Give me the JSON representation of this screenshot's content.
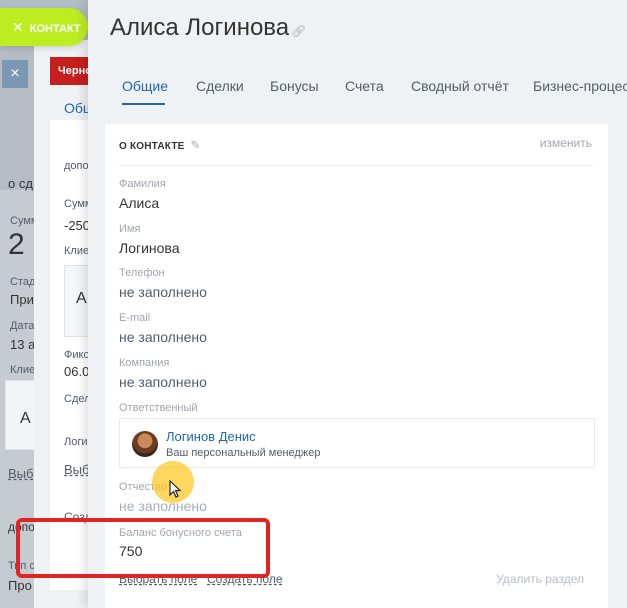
{
  "colors": {
    "accent": "#2067b0",
    "contact_button": "#bbed21",
    "highlight": "#e02424",
    "cursor_halo": "#ffc828"
  },
  "background": {
    "contact_button_label": "КОНТАКТ",
    "red_button_label": "Черно",
    "close_label": "×",
    "layer1": {
      "texts": [
        "о сд",
        "Сумм",
        "2",
        "Стад",
        "При",
        "Дата",
        "13 а",
        "Клие",
        "А",
        "Выб",
        "допо",
        "Тип с",
        "Про"
      ]
    },
    "layer2": {
      "texts": [
        "Общ",
        "допо",
        "Сумм",
        "-250",
        "Клие",
        "А",
        "Фикс",
        "06.0",
        "Сдел",
        "Логи",
        "Выб",
        "Созд"
      ]
    }
  },
  "header": {
    "title": "Алиса  Логинова"
  },
  "tabs": [
    {
      "label": "Общие",
      "active": true
    },
    {
      "label": "Сделки",
      "active": false
    },
    {
      "label": "Бонусы",
      "active": false
    },
    {
      "label": "Счета",
      "active": false
    },
    {
      "label": "Сводный отчёт",
      "active": false
    },
    {
      "label": "Бизнес-процессы",
      "active": false
    }
  ],
  "card": {
    "heading": "О КОНТАКТЕ",
    "change_label": "изменить",
    "fields": [
      {
        "label": "Фамилия",
        "value": "Алиса"
      },
      {
        "label": "Имя",
        "value": "Логинова"
      },
      {
        "label": "Телефон",
        "value": "не заполнено"
      },
      {
        "label": "E-mail",
        "value": "не заполнено"
      },
      {
        "label": "Компания",
        "value": "не заполнено"
      }
    ],
    "responsible": {
      "label": "Ответственный",
      "name": "Логинов Денис",
      "subtitle": "Ваш персональный менеджер"
    },
    "patronymic": {
      "label": "Отчество",
      "value": "не заполнено"
    },
    "bonus": {
      "label": "Баланс бонусного счета",
      "value": "750"
    },
    "footer": {
      "select_field": "Выбрать поле",
      "create_field": "Создать поле",
      "delete_section": "Удалить раздел"
    }
  }
}
